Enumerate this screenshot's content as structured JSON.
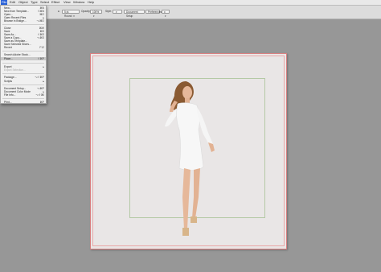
{
  "menubar": {
    "items": [
      "File",
      "Edit",
      "Object",
      "Type",
      "Select",
      "Effect",
      "View",
      "Window",
      "Help"
    ],
    "active": "File"
  },
  "controlbar": {
    "preset_label": "5 pt. Round",
    "opacity_label": "Opacity:",
    "opacity_value": "100%",
    "style_label": "Style:",
    "document_setup": "Document Setup",
    "preferences": "Preferences"
  },
  "file_menu": {
    "items": [
      {
        "label": "New...",
        "shortcut": "⌘N"
      },
      {
        "label": "New from Template...",
        "shortcut": "⇧⌘N"
      },
      {
        "label": "Open...",
        "shortcut": "⌘O"
      },
      {
        "label": "Open Recent Files",
        "arrow": "▸"
      },
      {
        "label": "Browse in Bridge...",
        "shortcut": "⌥⌘O"
      },
      {
        "label": "Close",
        "shortcut": "⌘W"
      },
      {
        "label": "Save",
        "shortcut": "⌘S"
      },
      {
        "label": "Save As...",
        "shortcut": "⇧⌘S"
      },
      {
        "label": "Save a Copy...",
        "shortcut": "⌥⌘S"
      },
      {
        "label": "Save as Template..."
      },
      {
        "label": "Save Selected Slices..."
      },
      {
        "label": "Revert",
        "shortcut": "F12"
      },
      {
        "label": "Search Adobe Stock..."
      },
      {
        "label": "Place...",
        "shortcut": "⇧⌘P"
      },
      {
        "label": "Export",
        "arrow": "▸"
      },
      {
        "label": "Export Selection..."
      },
      {
        "label": "Package...",
        "shortcut": "⌥⇧⌘P"
      },
      {
        "label": "Scripts",
        "arrow": "▸"
      },
      {
        "label": "Document Setup...",
        "shortcut": "⌥⌘P"
      },
      {
        "label": "Document Color Mode",
        "arrow": "▸"
      },
      {
        "label": "File Info...",
        "shortcut": "⌥⇧⌘I"
      },
      {
        "label": "Print...",
        "shortcut": "⌘P"
      }
    ]
  },
  "colors": {
    "accent": "#2a62d8",
    "artboard_border": "#d77f80",
    "guide": "#b4c9a5",
    "canvas_bg": "#979797"
  }
}
